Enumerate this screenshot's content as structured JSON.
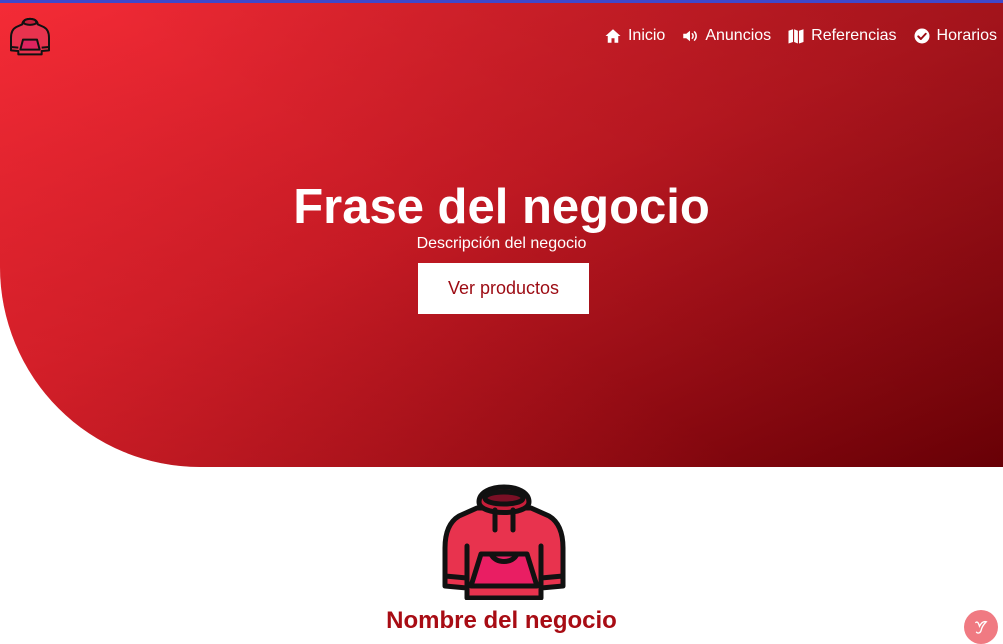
{
  "header": {
    "logo_icon": "hoodie-icon"
  },
  "nav": {
    "items": [
      {
        "label": "Inicio",
        "icon": "home-icon"
      },
      {
        "label": "Anuncios",
        "icon": "megaphone-icon"
      },
      {
        "label": "Referencias",
        "icon": "map-icon"
      },
      {
        "label": "Horarios",
        "icon": "check-circle-icon"
      }
    ]
  },
  "hero": {
    "title": "Frase del negocio",
    "description": "Descripción del negocio",
    "cta_label": "Ver productos"
  },
  "business": {
    "logo_icon": "hoodie-icon",
    "name": "Nombre del negocio"
  },
  "floating_badge": {
    "icon": "script-y-icon"
  },
  "colors": {
    "accent": "#a80c14",
    "gradient_start": "#f42b36",
    "gradient_end": "#6b0006",
    "top_line": "#3f48cc"
  }
}
